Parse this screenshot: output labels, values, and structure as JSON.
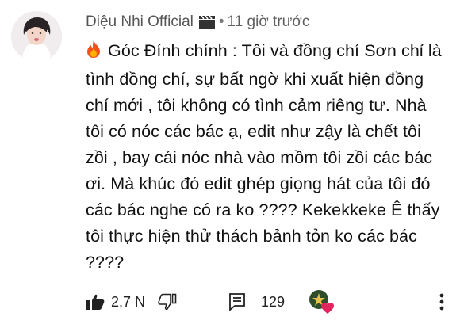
{
  "comment": {
    "author": "Diệu Nhi Official",
    "separator": "•",
    "time": "11 giờ trước",
    "text": "Góc Đính chính : Tôi và đồng chí Sơn chỉ là tình đồng chí, sự bất ngờ khi xuất hiện đồng chí mới , tôi không có tình cảm riêng tư. Nhà tôi có nóc các bác ạ, edit như zậy là chết tôi zồi , bay cái nóc nhà vào mồm tôi zồi các bác ơi. Mà khúc đó edit ghép giọng hát của tôi đó các bác nghe có ra ko ???? Kekekkeke Ê thấy tôi thực hiện thử thách bảnh tỏn ko các bác ????",
    "likes": "2,7 N",
    "replies": "129"
  },
  "icons": {
    "avatar": "avatar-icon",
    "video": "video-clapper-icon",
    "fire": "fire-icon",
    "like": "thumbs-up-icon",
    "dislike": "thumbs-down-icon",
    "reply": "reply-icon",
    "creator_heart": "creator-heart-icon",
    "more": "more-vert-icon"
  },
  "colors": {
    "heart": "#e0245e",
    "fire": "#f4511e",
    "text": "#111111",
    "meta": "#5f5f5f"
  }
}
